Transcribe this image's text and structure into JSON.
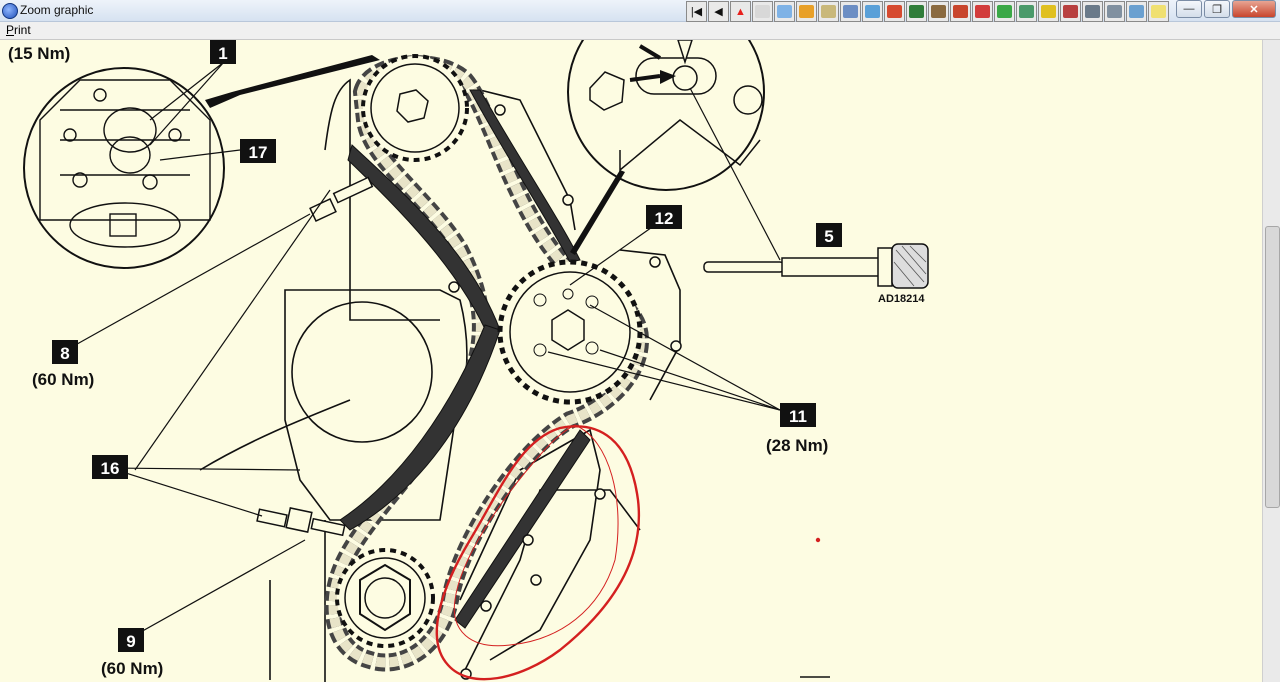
{
  "window": {
    "title": "Zoom graphic"
  },
  "menu": {
    "print": "Print"
  },
  "toolbar": {
    "buttons": [
      {
        "name": "first-page-button",
        "glyph": "|◀",
        "color": "#e9e9e9"
      },
      {
        "name": "prev-button",
        "glyph": "◀",
        "color": "#e9e9e9"
      },
      {
        "name": "warning-button",
        "glyph": "▲",
        "color": "#e8201c"
      },
      {
        "name": "document-button",
        "glyph": "",
        "color": "#d8d8d8"
      },
      {
        "name": "tool-button-1",
        "glyph": "",
        "color": "#7eb2e6"
      },
      {
        "name": "tool-button-2",
        "glyph": "",
        "color": "#e8a028"
      },
      {
        "name": "tool-button-3",
        "glyph": "",
        "color": "#c9b87a"
      },
      {
        "name": "tool-button-4",
        "glyph": "",
        "color": "#6c8ec4"
      },
      {
        "name": "tool-button-5",
        "glyph": "",
        "color": "#5aa0d8"
      },
      {
        "name": "tool-button-6",
        "glyph": "",
        "color": "#d64a30"
      },
      {
        "name": "tool-button-7",
        "glyph": "",
        "color": "#2f7d3a"
      },
      {
        "name": "tool-button-8",
        "glyph": "",
        "color": "#8a6a40"
      },
      {
        "name": "tool-button-9",
        "glyph": "",
        "color": "#c8452d"
      },
      {
        "name": "tool-button-10",
        "glyph": "",
        "color": "#d23c3c"
      },
      {
        "name": "tool-button-11",
        "glyph": "",
        "color": "#3aa847"
      },
      {
        "name": "tool-button-12",
        "glyph": "",
        "color": "#4a9a6a"
      },
      {
        "name": "tool-button-13",
        "glyph": "",
        "color": "#e0c020"
      },
      {
        "name": "tool-button-14",
        "glyph": "",
        "color": "#b84040"
      },
      {
        "name": "tool-button-15",
        "glyph": "",
        "color": "#6a7a8a"
      },
      {
        "name": "tool-button-16",
        "glyph": "",
        "color": "#8090a0"
      },
      {
        "name": "tool-button-17",
        "glyph": "",
        "color": "#6aa0d0"
      },
      {
        "name": "tool-button-18",
        "glyph": "",
        "color": "#f0e070"
      }
    ]
  },
  "window_controls": {
    "minimize": "—",
    "restore": "❐",
    "close": "✕"
  },
  "diagram": {
    "labels": {
      "l1": "1",
      "l17": "17",
      "l12": "12",
      "l5": "5",
      "l8": "8",
      "l11": "11",
      "l16": "16",
      "l9": "9"
    },
    "torques": {
      "t15": "(15 Nm)",
      "t8": "(60 Nm)",
      "t11": "(28 Nm)",
      "t9": "(60 Nm)"
    },
    "part_code": "AD18214"
  },
  "colors": {
    "background": "#fdfce2",
    "annotation": "#d42020"
  }
}
